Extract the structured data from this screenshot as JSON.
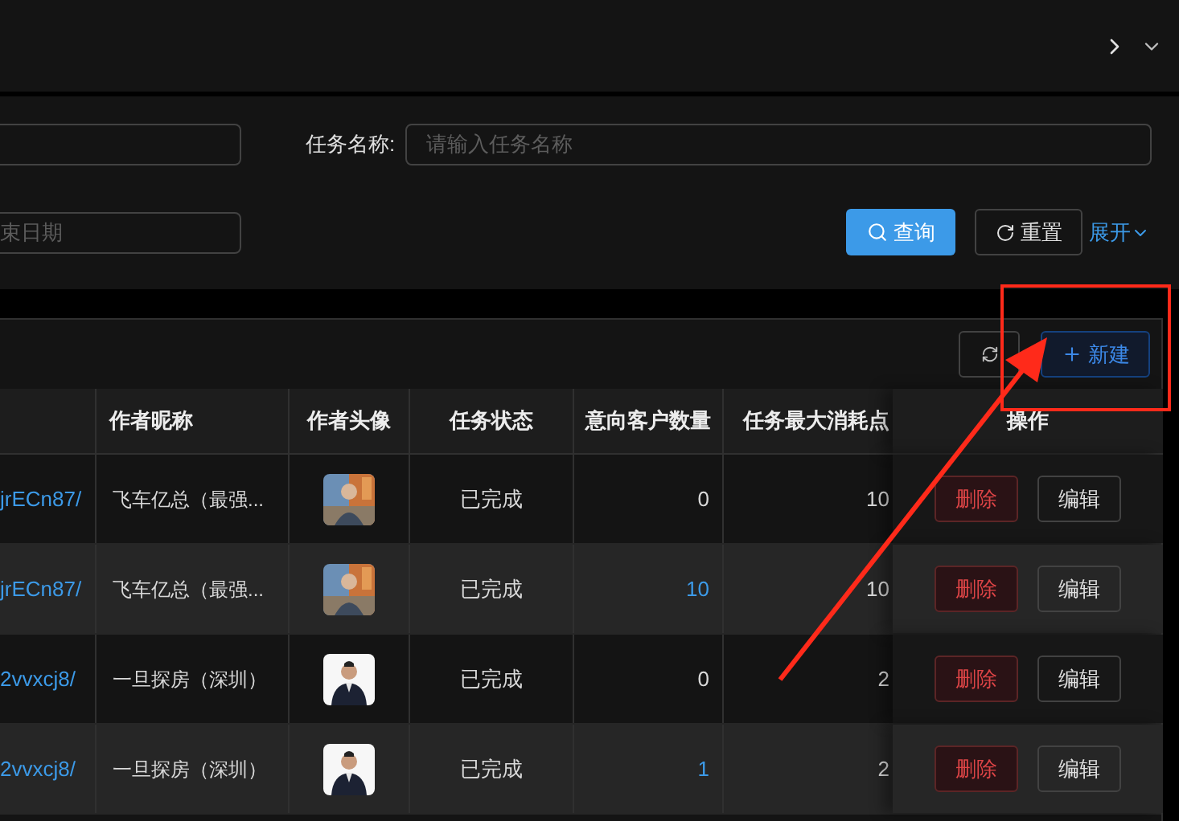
{
  "search_form": {
    "task_name": {
      "label": "任务名称:",
      "placeholder": "请输入任务名称"
    },
    "end_date": {
      "placeholder": "束日期"
    },
    "buttons": [
      {
        "kind": "primary",
        "label": "查询"
      },
      {
        "kind": "reset",
        "label": "重置"
      }
    ],
    "expand_link": "展开"
  },
  "toolbar": {
    "new_button": "新建"
  },
  "table": {
    "columns": [
      "作者昵称",
      "作者头像",
      "任务状态",
      "意向客户数量",
      "任务最大消耗点",
      "操作"
    ],
    "rows": [
      {
        "link": "jrECn87/",
        "nickname": "飞车亿总（最强...",
        "status": "已完成",
        "intent_count": "0",
        "count_is_link": false,
        "max_points": "10",
        "actions": [
          "删除",
          "编辑"
        ]
      },
      {
        "link": "jrECn87/",
        "nickname": "飞车亿总（最强...",
        "status": "已完成",
        "intent_count": "10",
        "count_is_link": true,
        "max_points": "10",
        "actions": [
          "删除",
          "编辑"
        ]
      },
      {
        "link": "2vvxcj8/",
        "nickname": "一旦探房（深圳）",
        "status": "已完成",
        "intent_count": "0",
        "count_is_link": false,
        "max_points": "2",
        "actions": [
          "删除",
          "编辑"
        ]
      },
      {
        "link": "2vvxcj8/",
        "nickname": "一旦探房（深圳）",
        "status": "已完成",
        "intent_count": "1",
        "count_is_link": true,
        "max_points": "2",
        "actions": [
          "删除",
          "编辑"
        ]
      }
    ]
  }
}
